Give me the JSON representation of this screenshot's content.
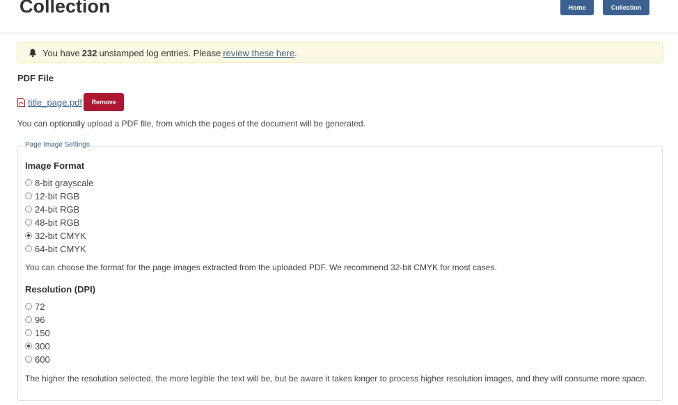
{
  "header": {
    "title": "Collection",
    "nav": {
      "home_label": "Home",
      "collection_label": "Collection"
    }
  },
  "alert": {
    "prefix": "You have",
    "count": "232",
    "middle": "unstamped log entries. Please",
    "link_text": "review these here",
    "suffix": "."
  },
  "pdf": {
    "label": "PDF File",
    "filename": "title_page.pdf",
    "remove_label": "Remove",
    "help": "You can optionally upload a PDF file, from which the pages of the document will be generated."
  },
  "settings": {
    "legend": "Page Image Settings",
    "format": {
      "label": "Image Format",
      "options": [
        "8-bit grayscale",
        "12-bit RGB",
        "24-bit RGB",
        "48-bit RGB",
        "32-bit CMYK",
        "64-bit CMYK"
      ],
      "selected": "32-bit CMYK",
      "help": "You can choose the format for the page images extracted from the uploaded PDF. We recommend 32-bit CMYK for most cases."
    },
    "resolution": {
      "label": "Resolution (DPI)",
      "options": [
        "72",
        "96",
        "150",
        "300",
        "600"
      ],
      "selected": "300",
      "help": "The higher the resolution selected, the more legible the text will be, but be aware it takes longer to process higher resolution images, and they will consume more space."
    }
  },
  "colors": {
    "primary": "#3b6191",
    "danger": "#ae1732",
    "alert_bg": "#fcf8e3"
  },
  "icons": {
    "alert": "bell-icon",
    "file": "pdf-file-icon"
  }
}
